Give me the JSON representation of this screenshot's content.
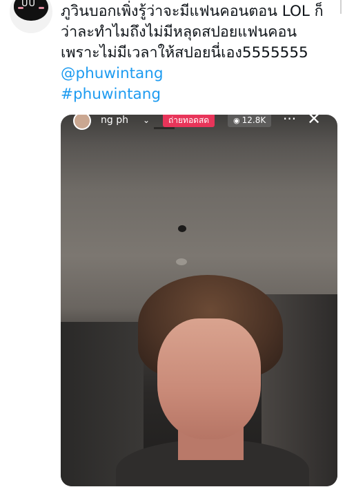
{
  "tweet": {
    "avatar_eyes": "UU",
    "lines": [
      "ภูวินบอกเพิ่งรู้ว่าจะมีแฟนคอนตอน LOL ก็",
      "ว่าละทำไมถึงไม่มีหลุดสปอยแฟนคอน",
      "เพราะไม่มีเวลาให้สปอยนี่เอง5555555"
    ],
    "mention": "@phuwintang",
    "hashtag": "#phuwintang",
    "link_color": "#1d9bf0"
  },
  "media": {
    "live_header": {
      "username": "ng ph",
      "live_label": "ถ่ายทอดสด",
      "live_label_color": "#e8355a",
      "viewer_count": "12.8K",
      "icons": [
        "chevron-down-icon",
        "eye-icon",
        "more-icon",
        "close-icon"
      ]
    }
  }
}
